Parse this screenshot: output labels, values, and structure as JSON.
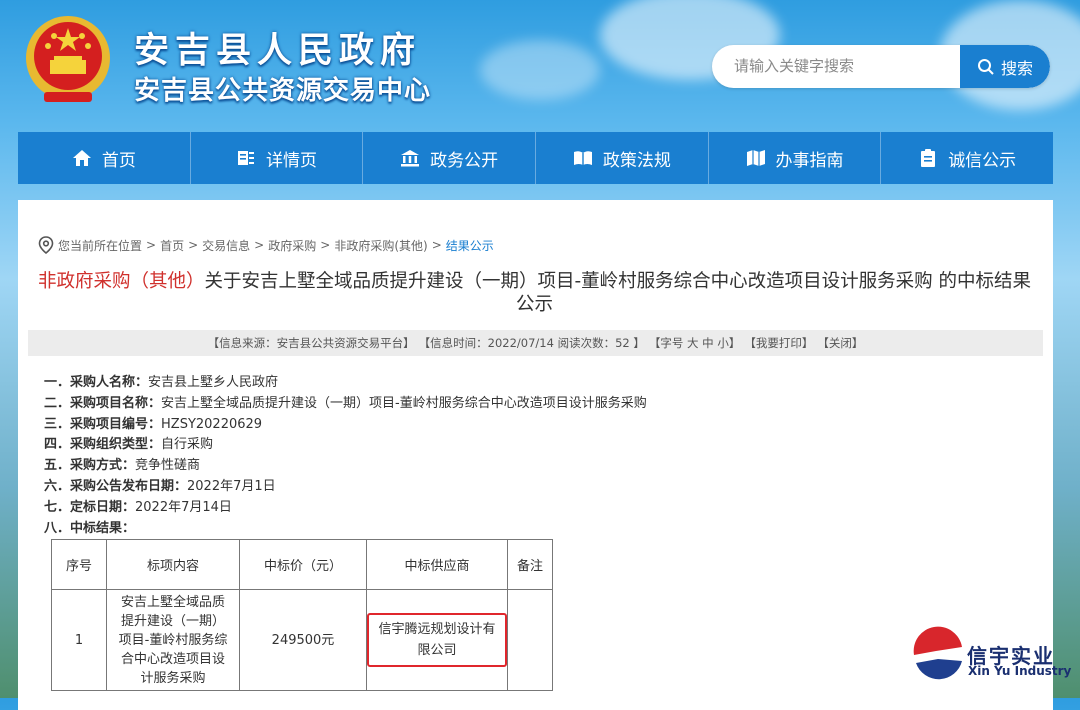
{
  "header": {
    "title": "安吉县人民政府",
    "subtitle": "安吉县公共资源交易中心",
    "search": {
      "placeholder": "请输入关键字搜索",
      "button": "搜索"
    }
  },
  "nav": [
    {
      "label": "首页",
      "icon": "home-icon"
    },
    {
      "label": "详情页",
      "icon": "list-icon"
    },
    {
      "label": "政务公开",
      "icon": "government-building-icon"
    },
    {
      "label": "政策法规",
      "icon": "book-icon"
    },
    {
      "label": "办事指南",
      "icon": "map-icon"
    },
    {
      "label": "诚信公示",
      "icon": "clipboard-icon"
    }
  ],
  "breadcrumb": [
    "您当前所在位置",
    "首页",
    "交易信息",
    "政府采购",
    "非政府采购(其他)",
    "结果公示"
  ],
  "article": {
    "category": "非政府采购（其他）",
    "title": "关于安吉上墅全域品质提升建设（一期）项目-董岭村服务综合中心改造项目设计服务采购 的中标结果公示",
    "info": {
      "source": "【信息来源：安吉县公共资源交易平台】",
      "time": "【信息时间：2022/07/14 阅读次数：52 】",
      "fontsize": "【字号 大 中 小】",
      "print": "【我要打印】",
      "close": "【关闭】"
    },
    "details": [
      {
        "label": "一．采购人名称：",
        "value": "安吉县上墅乡人民政府"
      },
      {
        "label": "二．采购项目名称：",
        "value": "安吉上墅全域品质提升建设（一期）项目-董岭村服务综合中心改造项目设计服务采购"
      },
      {
        "label": "三．采购项目编号：",
        "value": "HZSY20220629"
      },
      {
        "label": "四．采购组织类型：",
        "value": "自行采购"
      },
      {
        "label": "五．采购方式：",
        "value": "竞争性磋商"
      },
      {
        "label": "六．采购公告发布日期：",
        "value": "2022年7月1日"
      },
      {
        "label": "七．定标日期：",
        "value": "2022年7月14日"
      },
      {
        "label": "八．中标结果：",
        "value": ""
      }
    ],
    "table": {
      "headers": [
        "序号",
        "标项内容",
        "中标价（元）",
        "中标供应商",
        "备注"
      ],
      "rows": [
        [
          "1",
          "安吉上墅全域品质提升建设（一期）项目-董岭村服务综合中心改造项目设计服务采购",
          "249500元",
          "信宇腾远规划设计有限公司",
          ""
        ]
      ]
    }
  },
  "watermark": {
    "name": "信宇实业",
    "english": "Xin Yu Industry"
  },
  "colors": {
    "primary": "#1a7fd0",
    "highlight": "#d0312d",
    "box": "#e0262c"
  }
}
